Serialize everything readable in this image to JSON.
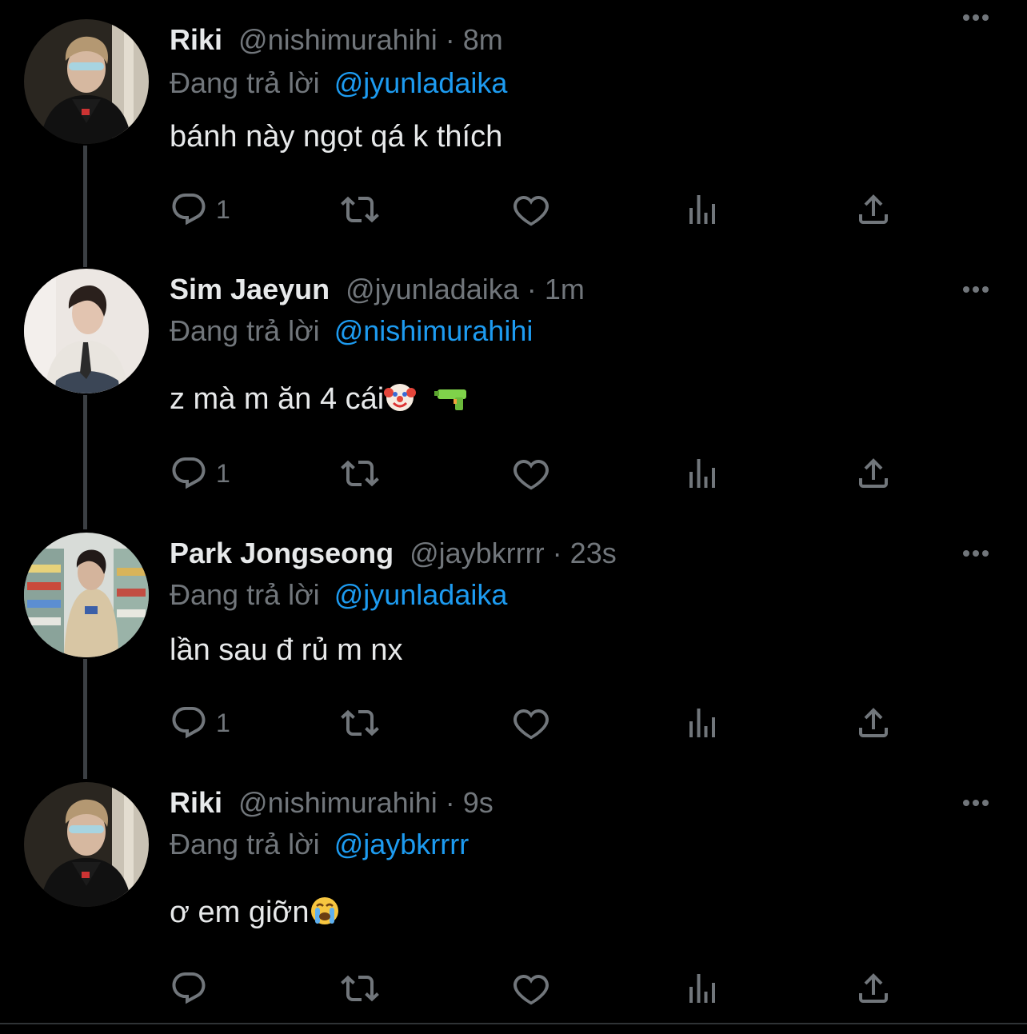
{
  "tweets": [
    {
      "name": "Riki",
      "handle": "@nishimurahihi",
      "dot": "·",
      "time": "8m",
      "reply_prefix": "Đang trả lời",
      "reply_to": "@jyunladaika",
      "text": "bánh này ngọt qá k thích",
      "reply_count": "1",
      "avatar": "riki-avatar"
    },
    {
      "name": "Sim Jaeyun",
      "handle": "@jyunladaika",
      "dot": "·",
      "time": "1m",
      "reply_prefix": "Đang trả lời",
      "reply_to": "@nishimurahihi",
      "text": "z mà m ăn 4 cái",
      "text_emojis": [
        "clown-face",
        "water-pistol"
      ],
      "reply_count": "1",
      "avatar": "jaeyun-avatar"
    },
    {
      "name": "Park Jongseong",
      "handle": "@jaybkrrrr",
      "dot": "·",
      "time": "23s",
      "reply_prefix": "Đang trả lời",
      "reply_to": "@jyunladaika",
      "text": "lần sau đ rủ m nx",
      "reply_count": "1",
      "avatar": "jongseong-avatar"
    },
    {
      "name": "Riki",
      "handle": "@nishimurahihi",
      "dot": "·",
      "time": "9s",
      "reply_prefix": "Đang trả lời",
      "reply_to": "@jaybkrrrr",
      "text": "ơ em giỡn",
      "text_emojis": [
        "loudly-crying-face"
      ],
      "reply_count": "",
      "avatar": "riki-avatar"
    }
  ],
  "colors": {
    "background": "#000000",
    "text": "#e7e9ea",
    "muted": "#71767b",
    "link": "#1d9bf0",
    "thread_line": "#3b3f43"
  }
}
